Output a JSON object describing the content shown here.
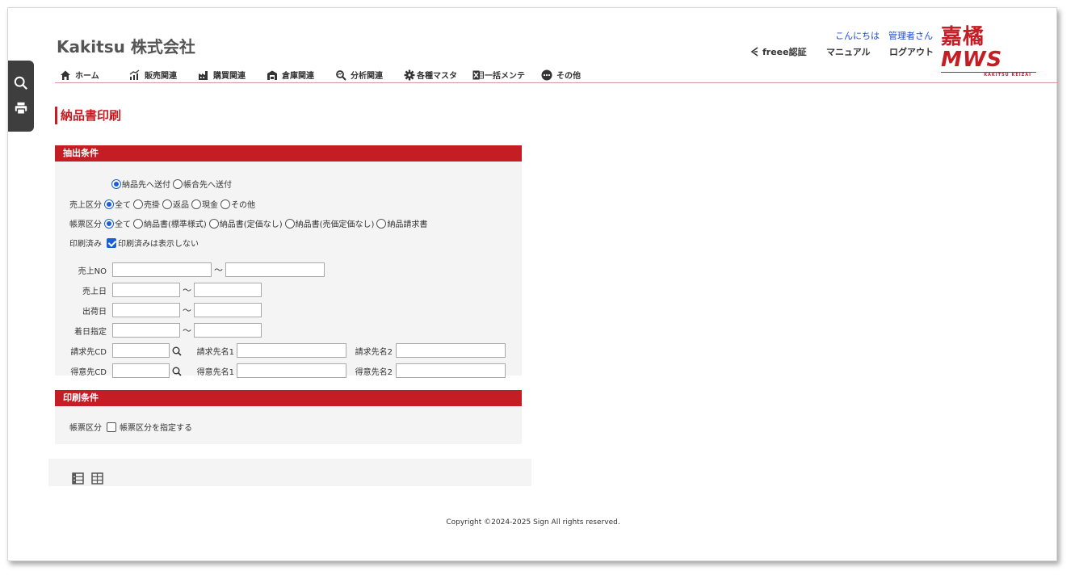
{
  "header": {
    "company": "Kakitsu 株式会社",
    "greeting": "こんにちは",
    "user": "管理者さん",
    "freee": "freee認証",
    "manual": "マニュアル",
    "logout": "ログアウト",
    "logo_main": "嘉橘",
    "logo_mws": "MWS",
    "logo_sub": "KAKITSU KEIZAI"
  },
  "nav": {
    "home": "ホーム",
    "sales": "販売関連",
    "purchase": "購買関連",
    "warehouse": "倉庫関連",
    "analysis": "分析関連",
    "master": "各種マスタ",
    "bulk": "一括メンテ",
    "other": "その他"
  },
  "page": {
    "title": "納品書印刷"
  },
  "extract": {
    "heading": "抽出条件",
    "send_options": [
      "納品先へ送付",
      "帳合先へ送付"
    ],
    "send_selected": 0,
    "sales_type_label": "売上区分",
    "sales_type_options": [
      "全て",
      "売掛",
      "返品",
      "現金",
      "その他"
    ],
    "sales_type_selected": 0,
    "form_type_label": "帳票区分",
    "form_type_options": [
      "全て",
      "納品書(標準様式)",
      "納品書(定価なし)",
      "納品書(売価定価なし)",
      "納品請求書"
    ],
    "form_type_selected": 0,
    "printed_label": "印刷済み",
    "printed_checkbox": "印刷済みは表示しない",
    "printed_checked": true,
    "sales_no_label": "売上NO",
    "sales_date_label": "売上日",
    "ship_date_label": "出荷日",
    "arrival_label": "着日指定",
    "tilde": "～",
    "billing_cd_label": "請求先CD",
    "billing_name1_label": "請求先名1",
    "billing_name2_label": "請求先名2",
    "customer_cd_label": "得意先CD",
    "customer_name1_label": "得意先名1",
    "customer_name2_label": "得意先名2"
  },
  "print": {
    "heading": "印刷条件",
    "form_type_label": "帳票区分",
    "form_type_checkbox": "帳票区分を指定する",
    "form_type_checked": false
  },
  "footer": {
    "copyright": "Copyright ©2024-2025 Sign All rights reserved."
  },
  "icons": [
    "search-icon",
    "print-icon",
    "home-icon",
    "chart-icon",
    "factory-icon",
    "warehouse-icon",
    "analysis-icon",
    "gear-icon",
    "excel-icon",
    "more-icon",
    "list-view-icon",
    "grid-view-icon"
  ],
  "colors": {
    "accent": "#c41e24",
    "link": "#1a4bd6",
    "radio": "#1a5fd6"
  }
}
